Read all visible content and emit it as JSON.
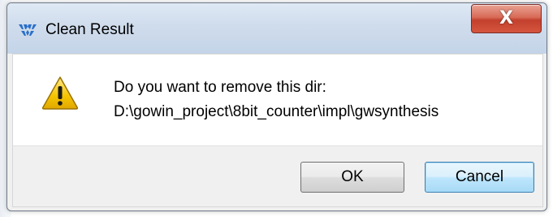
{
  "dialog": {
    "title": "Clean Result",
    "close_label": "X",
    "title_icon": "gowin-logo-icon",
    "message_icon": "warning-icon",
    "message_line1": "Do you want to remove this dir:",
    "message_line2": "D:\\gowin_project\\8bit_counter\\impl\\gwsynthesis",
    "buttons": {
      "ok": "OK",
      "cancel": "Cancel"
    }
  },
  "colors": {
    "titlebar": "#cfdcec",
    "close_button": "#c2402d",
    "focus_button": "#bee6fd",
    "warning_fill": "#f5c400"
  }
}
